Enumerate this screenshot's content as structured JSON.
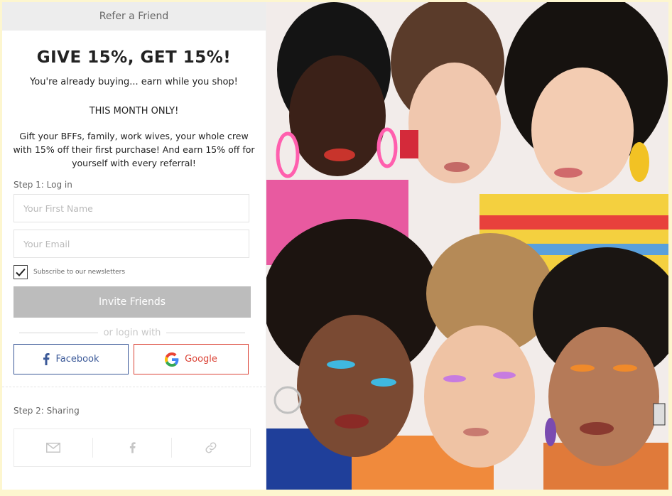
{
  "panel": {
    "header_title": "Refer a Friend",
    "headline": "GIVE 15%, GET 15%!",
    "subline": "You're already buying... earn while you shop!",
    "month_note": "THIS MONTH ONLY!",
    "body_copy": "Gift your BFFs, family, work wives, your whole crew with 15% off their first purchase! And earn 15% off for yourself with every referral!",
    "step1_label": "Step 1: Log in",
    "first_name_placeholder": "Your First Name",
    "first_name_value": "",
    "email_placeholder": "Your Email",
    "email_value": "",
    "subscribe_checked": true,
    "subscribe_label": "Subscribe to our newsletters",
    "invite_button": "Invite Friends",
    "divider_text": "or login with",
    "facebook_label": "Facebook",
    "google_label": "Google",
    "step2_label": "Step 2: Sharing",
    "share_icons": [
      "mail-icon",
      "facebook-icon",
      "link-icon"
    ]
  },
  "colors": {
    "page_background": "#fdf6cf",
    "header_background": "#ededed",
    "invite_button": "#bcbcbc",
    "facebook": "#3b5998",
    "google": "#db4437"
  }
}
